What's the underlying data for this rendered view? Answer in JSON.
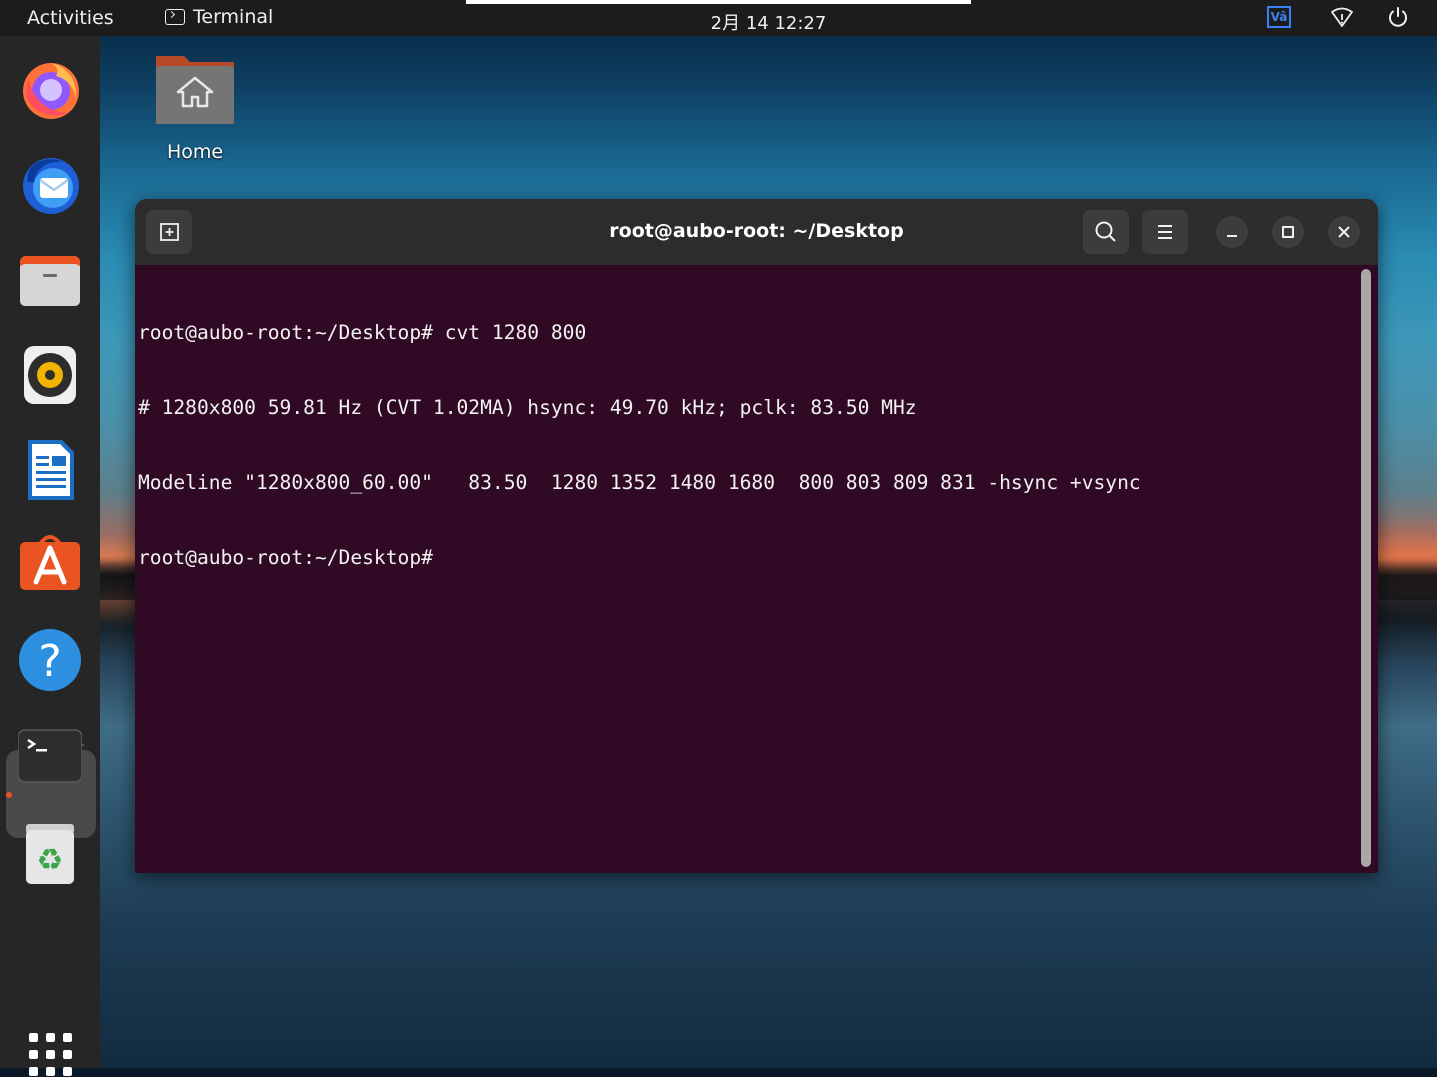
{
  "topbar": {
    "activities": "Activities",
    "app_name": "Terminal",
    "clock": "2月 14 12:27",
    "tray_icons": [
      "vscode-icon",
      "network-icon",
      "power-icon"
    ],
    "vs_label": "Vâ"
  },
  "desktop": {
    "home_label": "Home"
  },
  "dock": {
    "items": [
      "Firefox",
      "Thunderbird",
      "Files",
      "Rhythmbox",
      "LibreOffice Writer",
      "Ubuntu Software",
      "Help",
      "Terminal",
      "Trash"
    ],
    "active": "Terminal",
    "accent_color": "#e95420"
  },
  "terminal": {
    "title": "root@aubo-root: ~/Desktop",
    "background_color": "#300a24",
    "lines": [
      "root@aubo-root:~/Desktop# cvt 1280 800",
      "# 1280x800 59.81 Hz (CVT 1.02MA) hsync: 49.70 kHz; pclk: 83.50 MHz",
      "Modeline \"1280x800_60.00\"   83.50  1280 1352 1480 1680  800 803 809 831 -hsync +vsync",
      "root@aubo-root:~/Desktop#"
    ]
  }
}
